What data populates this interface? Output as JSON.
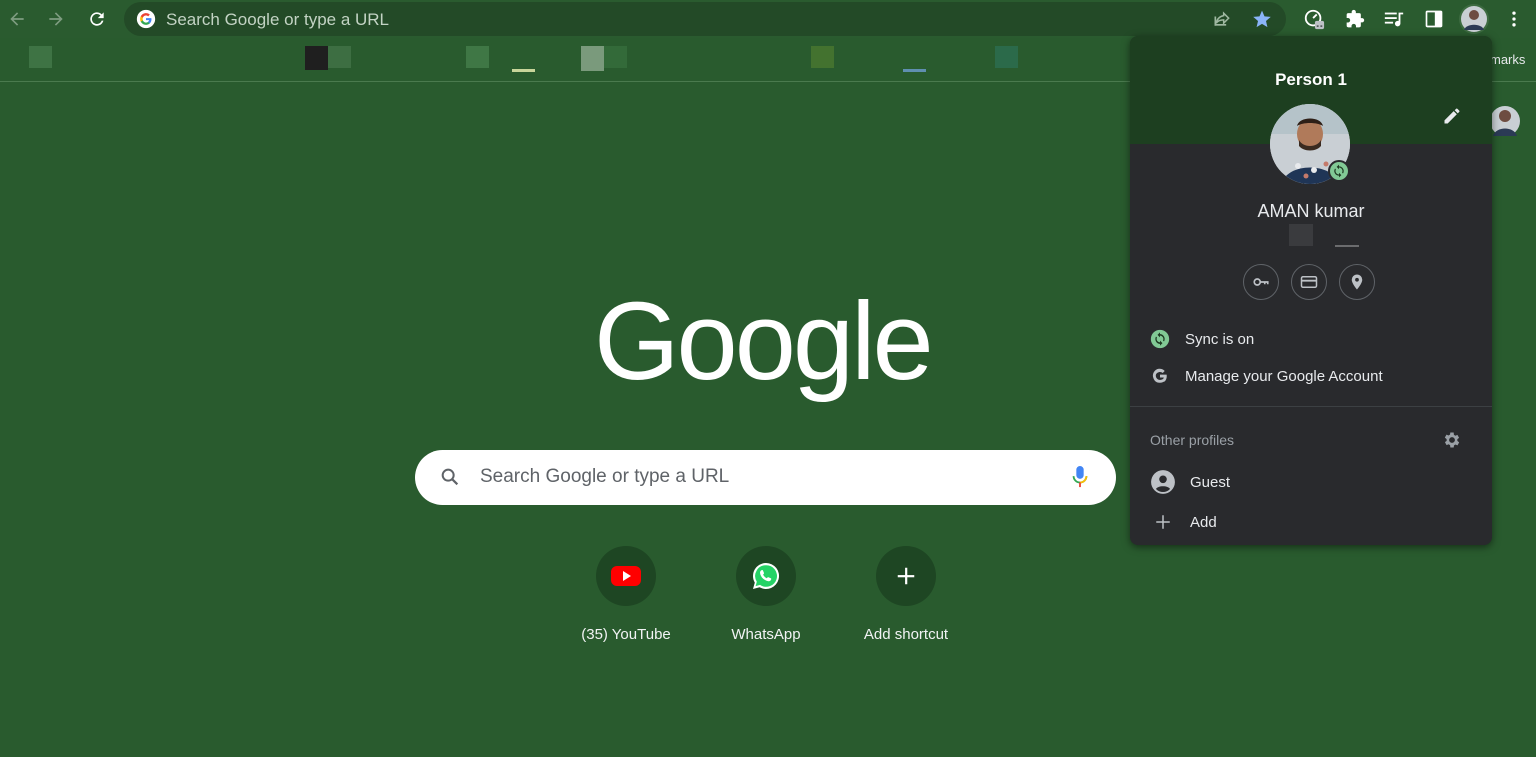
{
  "toolbar": {
    "omnibox_placeholder": "Search Google or type a URL"
  },
  "bookmarks": {
    "overflow_label": "marks"
  },
  "ntp": {
    "logo_text": "Google",
    "search_placeholder": "Search Google or type a URL",
    "shortcuts": [
      {
        "label": "(35) YouTube",
        "icon": "youtube-icon"
      },
      {
        "label": "WhatsApp",
        "icon": "whatsapp-icon"
      },
      {
        "label": "Add shortcut",
        "icon": "plus-icon"
      }
    ]
  },
  "profile_menu": {
    "title": "Person 1",
    "user_name": "AMAN kumar",
    "quick_actions": [
      "key-icon",
      "card-icon",
      "location-icon"
    ],
    "sync_label": "Sync is on",
    "manage_label": "Manage your Google Account",
    "other_profiles_label": "Other profiles",
    "guest_label": "Guest",
    "add_label": "Add"
  },
  "colors": {
    "background": "#295b2e",
    "popup_bg": "#292a2d",
    "popup_header": "#1d3f20",
    "sync_green": "#81c995",
    "star_blue": "#8ab4f8"
  }
}
